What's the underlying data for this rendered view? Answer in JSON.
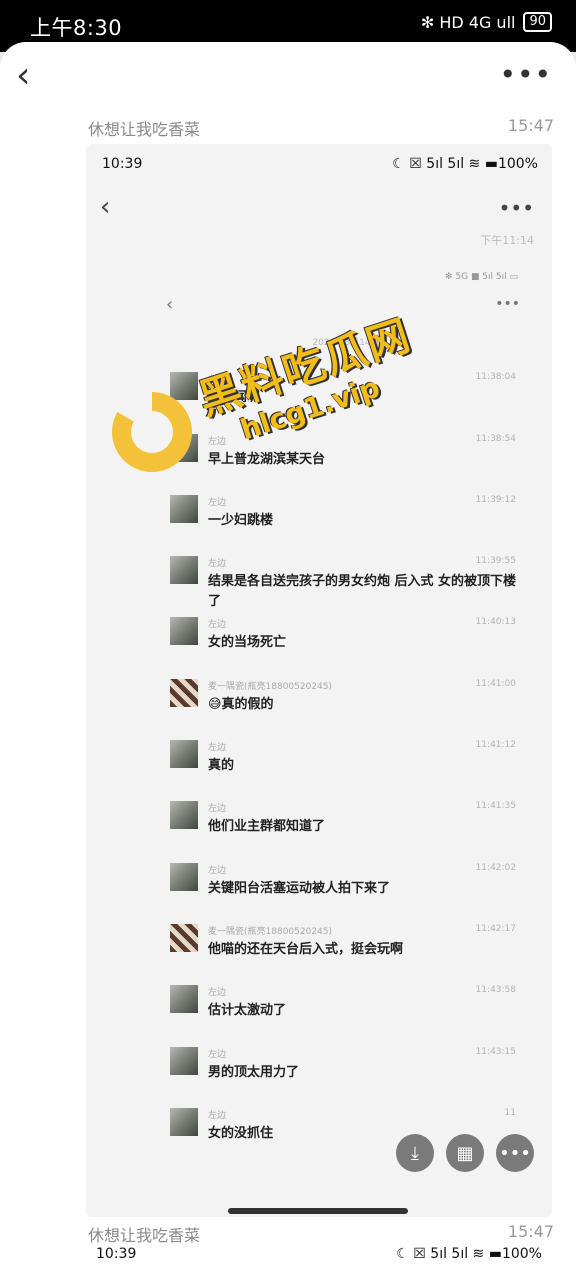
{
  "status_bar": {
    "time": "上午8:30",
    "icons": "✻ HD 4G ull",
    "battery": "90"
  },
  "chat": {
    "sender": "休想让我吃香菜",
    "time": "15:47"
  },
  "inner": {
    "time": "10:39",
    "status_right": "☾ ☒ 5ıl 5ıl ≋ ▬100%",
    "chat_time": "下午11:14"
  },
  "deep": {
    "status": "✻ 5G ■ 5ıl 5ıl ▭",
    "date": "2024年3月14日"
  },
  "watermark": {
    "cn": "黑料吃瓜网",
    "url": "hlcg1.vip"
  },
  "messages": [
    {
      "name": "左边",
      "time": "11:38:04",
      "text": "大新闻呢",
      "type": "a"
    },
    {
      "name": "左边",
      "time": "11:38:54",
      "text": "早上普龙湖滨某天台",
      "type": "a"
    },
    {
      "name": "左边",
      "time": "11:39:12",
      "text": "一少妇跳楼",
      "type": "a"
    },
    {
      "name": "左边",
      "time": "11:39:55",
      "text": "结果是各自送完孩子的男女约炮 后入式 女的被顶下楼了",
      "type": "a"
    },
    {
      "name": "左边",
      "time": "11:40:13",
      "text": "女的当场死亡",
      "type": "a"
    },
    {
      "name": "麦一隅瓷(瓶亮18800520245)",
      "time": "11:41:00",
      "text": "😅真的假的",
      "type": "b"
    },
    {
      "name": "左边",
      "time": "11:41:12",
      "text": "真的",
      "type": "a"
    },
    {
      "name": "左边",
      "time": "11:41:35",
      "text": "他们业主群都知道了",
      "type": "a"
    },
    {
      "name": "左边",
      "time": "11:42:02",
      "text": "关键阳台活塞运动被人拍下来了",
      "type": "a"
    },
    {
      "name": "麦一隅瓷(瓶亮18800520245)",
      "time": "11:42:17",
      "text": "他喵的还在天台后入式，挺会玩啊",
      "type": "b"
    },
    {
      "name": "左边",
      "time": "11:43:58",
      "text": "估计太激动了",
      "type": "a"
    },
    {
      "name": "左边",
      "time": "11:43:15",
      "text": "男的顶太用力了",
      "type": "a"
    },
    {
      "name": "左边",
      "time": "11",
      "text": "女的没抓住",
      "type": "a"
    }
  ],
  "fabs": [
    "⤓",
    "▦",
    "•••"
  ],
  "bottom": {
    "sender": "休想让我吃香菜",
    "time": "15:47",
    "status_time": "10:39",
    "status_right": "☾ ☒ 5ıl 5ıl ≋ ▬100%"
  }
}
